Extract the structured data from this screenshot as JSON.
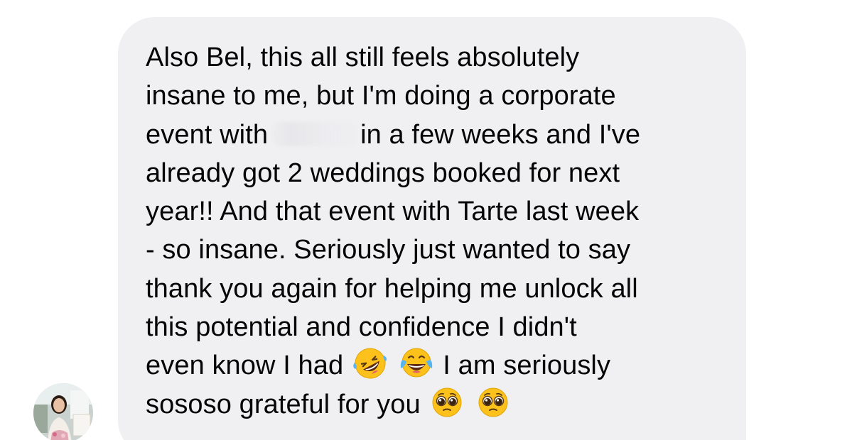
{
  "message": {
    "line1": "Also Bel, this all still feels absolutely",
    "line2": "insane to me, but I'm doing a corporate",
    "line3_before": "event with",
    "line3_after": "in a few weeks and I've",
    "line4": "already got 2 weddings booked for next",
    "line5": "year!! And that event with Tarte last week",
    "line6": "- so insane. Seriously just wanted to say",
    "line7": "thank you again for helping me unlock all",
    "line8": "this potential and confidence I didn't",
    "line9_before": "even know I had",
    "line9_after": "I am seriously",
    "line10_before": "sososo grateful for you"
  },
  "emojis": {
    "rofl": "rofl-emoji",
    "tears_of_joy": "tears-of-joy-emoji",
    "pleading": "pleading-face-emoji"
  },
  "colors": {
    "bubble": "#f0f0f2",
    "text": "#050505",
    "emoji_yellow": "#fcc21b"
  }
}
